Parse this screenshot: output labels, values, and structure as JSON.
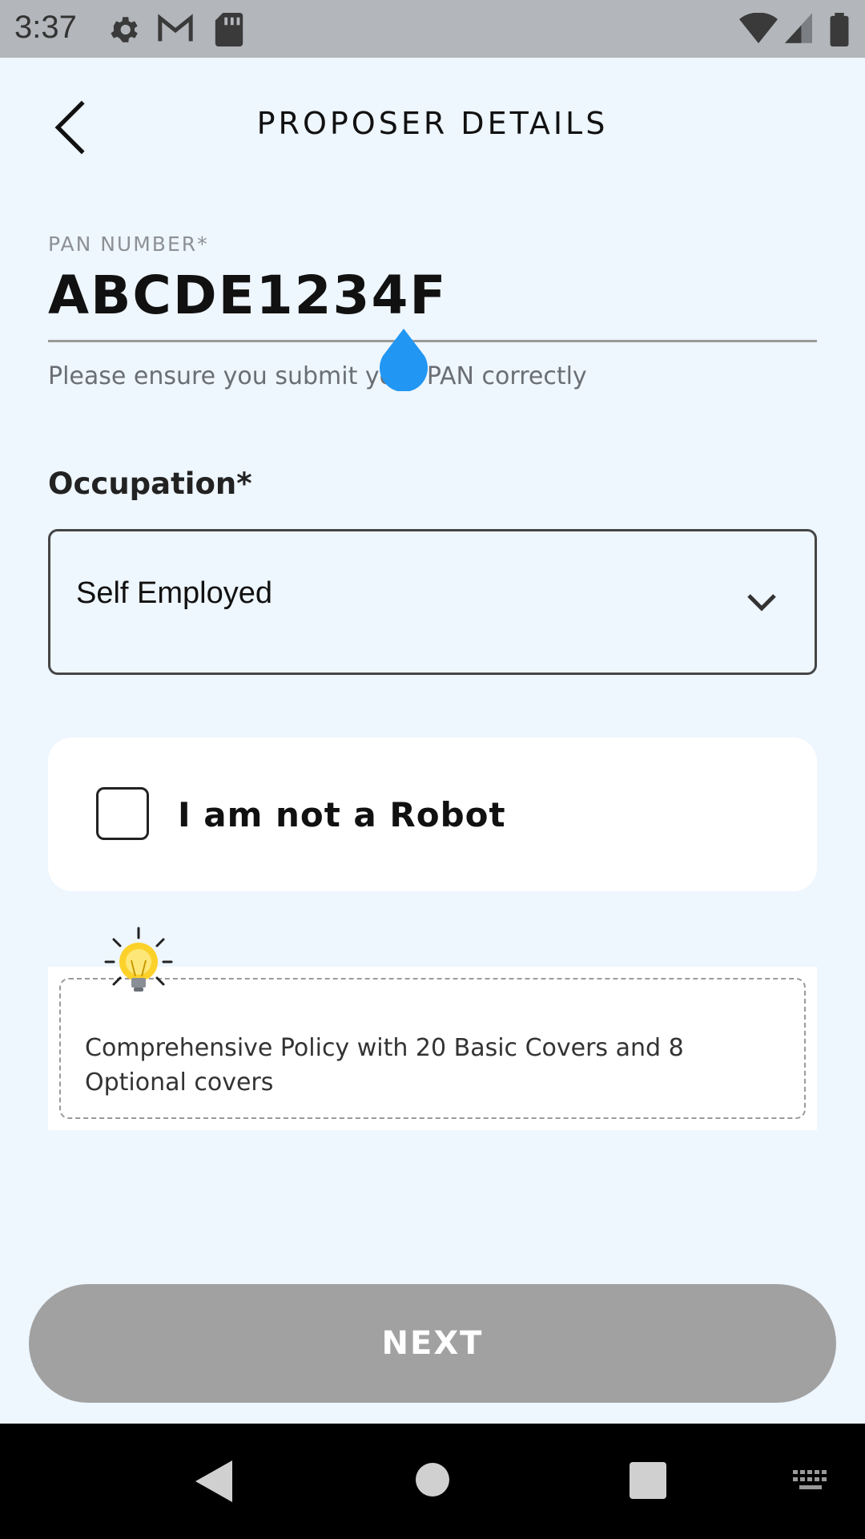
{
  "status_bar": {
    "time": "3:37",
    "icons": [
      "gear-icon",
      "gmail-icon",
      "sd-card-icon",
      "wifi-icon",
      "signal-icon",
      "battery-icon"
    ]
  },
  "header": {
    "title": "PROPOSER DETAILS",
    "back_icon": "chevron-left-icon"
  },
  "pan": {
    "label": "PAN NUMBER*",
    "value": "ABCDE1234F",
    "hint": "Please ensure you submit your PAN correctly"
  },
  "occupation": {
    "label": "Occupation*",
    "selected": "Self Employed",
    "icon": "chevron-down-icon"
  },
  "captcha": {
    "label": "I am not a Robot",
    "checked": false
  },
  "tip": {
    "icon": "lightbulb-icon",
    "text": "Comprehensive Policy with 20 Basic Covers and 8 Optional covers"
  },
  "next_button": {
    "label": "NEXT",
    "enabled": false
  },
  "colors": {
    "background": "#eef6fe",
    "status_bar": "#b3b6bb",
    "button_disabled": "#a1a1a1",
    "cursor_handle": "#2196f3"
  },
  "nav_bar": {
    "icons": [
      "nav-back-icon",
      "nav-home-icon",
      "nav-recents-icon",
      "keyboard-icon"
    ]
  }
}
